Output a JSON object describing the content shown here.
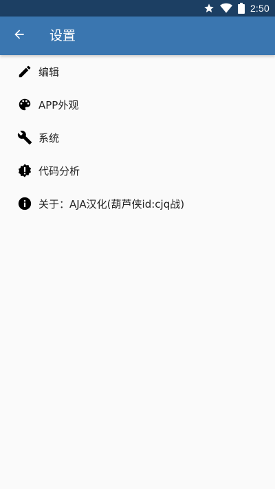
{
  "status_bar": {
    "time": "2:50",
    "icons": [
      "star-icon",
      "wifi-icon",
      "battery-icon"
    ]
  },
  "header": {
    "title": "设置",
    "back_icon": "arrow-back-icon"
  },
  "menu": {
    "items": [
      {
        "label": "编辑",
        "icon": "pencil-icon"
      },
      {
        "label": "APP外观",
        "icon": "palette-icon"
      },
      {
        "label": "系统",
        "icon": "wrench-icon"
      },
      {
        "label": "代码分析",
        "icon": "alert-badge-icon"
      },
      {
        "label": "关于：AJA汉化(葫芦侠id:cjq战)",
        "icon": "info-icon"
      }
    ]
  },
  "colors": {
    "status_bar": "#1c3f63",
    "app_bar": "#3a76b0",
    "background": "#fafafa",
    "text": "#212121",
    "icon": "#000000"
  }
}
